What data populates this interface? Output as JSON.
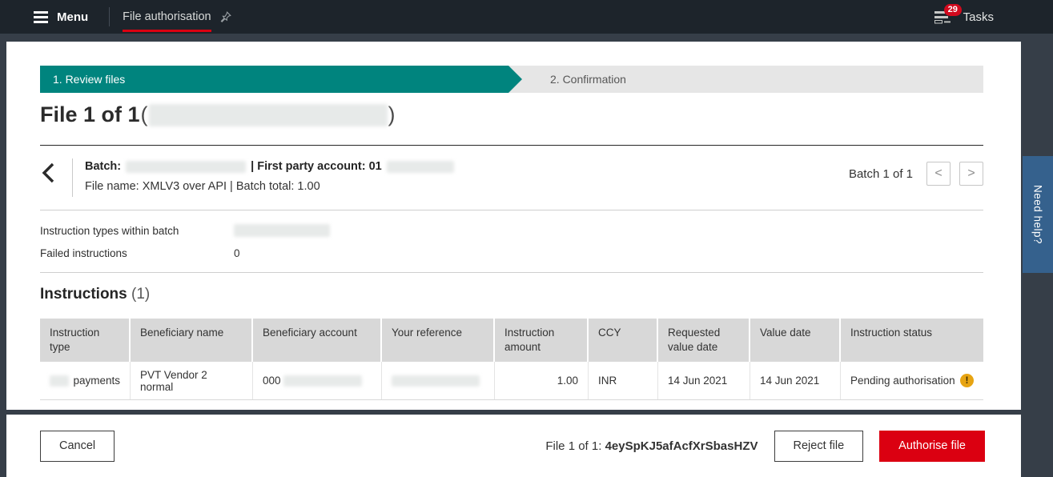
{
  "colors": {
    "brand_red": "#db0011",
    "step_teal": "#00847e",
    "warning_amber": "#e7a412",
    "help_blue": "#35618d",
    "topbar_bg": "#1d242b"
  },
  "topbar": {
    "menu_label": "Menu",
    "tab_label": "File authorisation",
    "tasks_label": "Tasks",
    "tasks_badge": "29"
  },
  "stepper": {
    "step1_label": "1. Review files",
    "step2_label": "2. Confirmation"
  },
  "page": {
    "title": "File 1 of 1",
    "paren_open": "(",
    "paren_close": ")"
  },
  "batch_nav": {
    "batch_label": "Batch:",
    "first_party_label": "| First party account: 01",
    "file_line": "File name: XMLV3 over API | Batch total: 1.00",
    "batch_counter": "Batch 1 of 1",
    "prev_glyph": "<",
    "next_glyph": ">"
  },
  "summary": {
    "row1_label": "Instruction types within batch",
    "row2_label": "Failed instructions",
    "row2_value": "0"
  },
  "instructions": {
    "heading": "Instructions",
    "count": "(1)"
  },
  "table": {
    "headers": [
      "Instruction type",
      "Beneficiary name",
      "Beneficiary account",
      "Your reference",
      "Instruction amount",
      "CCY",
      "Requested value date",
      "Value date",
      "Instruction status"
    ],
    "row": {
      "instruction_type_suffix": "payments",
      "beneficiary_name": "PVT Vendor 2 normal",
      "beneficiary_account_prefix": "000",
      "instruction_amount": "1.00",
      "ccy": "INR",
      "requested_value_date": "14 Jun 2021",
      "value_date": "14 Jun 2021",
      "instruction_status": "Pending authorisation",
      "warning_glyph": "!"
    }
  },
  "footer": {
    "cancel_label": "Cancel",
    "file_label": "File 1 of 1:",
    "file_id": "4eySpKJ5afAcfXrSbasHZV",
    "reject_label": "Reject file",
    "authorise_label": "Authorise file"
  },
  "help_tab": {
    "label": "Need help?"
  }
}
